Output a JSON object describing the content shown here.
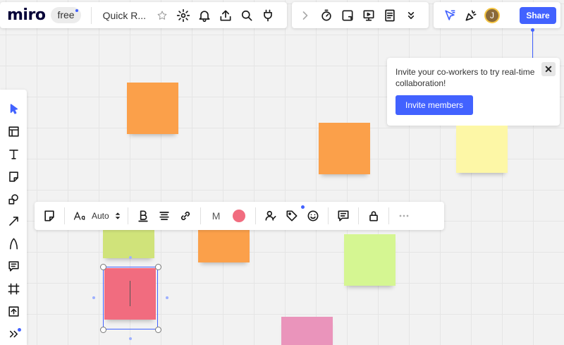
{
  "header": {
    "logo": "miro",
    "plan_badge": "free",
    "board_title": "Quick R...",
    "share_label": "Share",
    "avatar_initial": "J"
  },
  "invite_popover": {
    "message": "Invite your co-workers to try real-time collaboration!",
    "button_label": "Invite members",
    "close_label": "✕"
  },
  "context_toolbar": {
    "font_size_label": "Auto",
    "text_style_label": "M",
    "selected_color": "#f16c7f"
  },
  "colors": {
    "accent": "#4262ff",
    "sticky_orange": "#fba04a",
    "sticky_yellow": "#fdf7a6",
    "sticky_lime": "#d0e37a",
    "sticky_green": "#d5f692",
    "sticky_red": "#f16c7f",
    "sticky_pink": "#ea94bb"
  }
}
